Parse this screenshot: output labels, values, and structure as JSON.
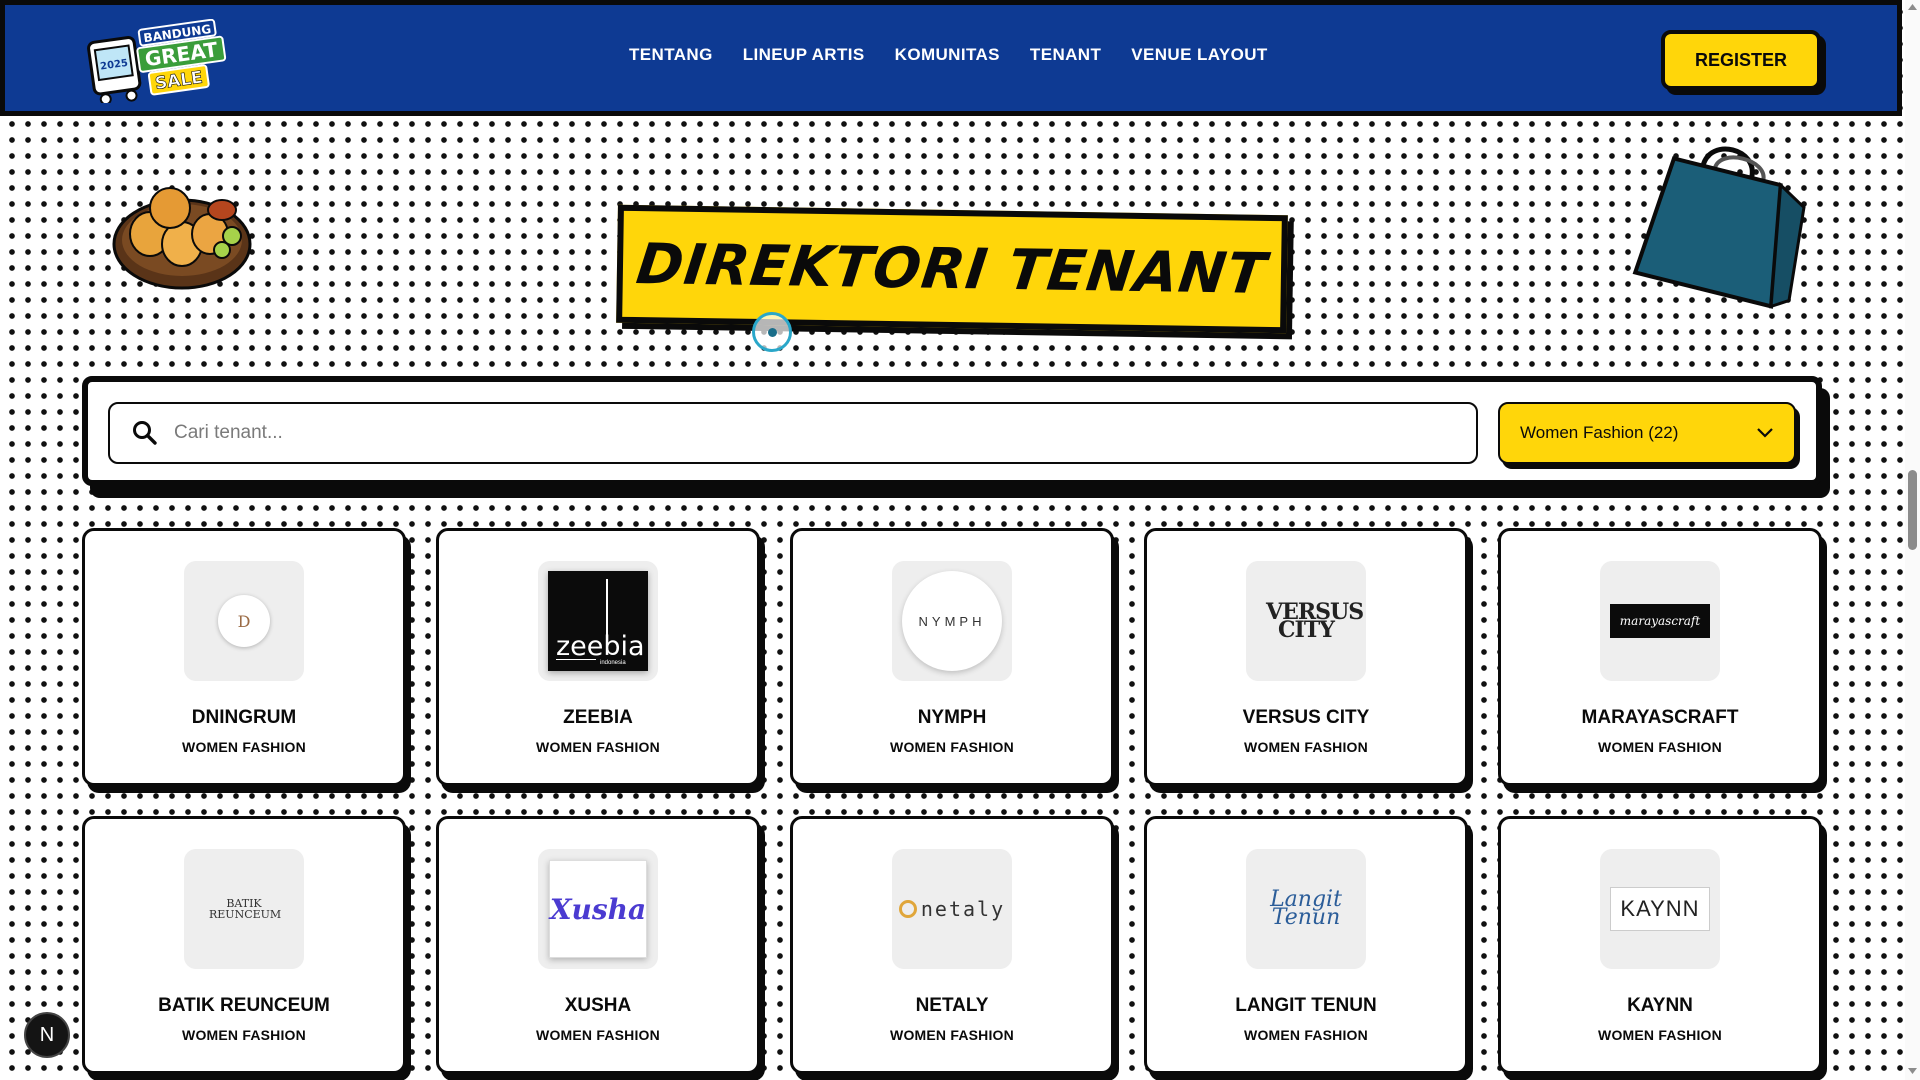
{
  "header": {
    "logo": {
      "year": "2025",
      "line1": "BANDUNG",
      "line2": "GREAT",
      "line3": "SALE"
    },
    "nav": [
      {
        "label": "TENTANG"
      },
      {
        "label": "LINEUP ARTIS"
      },
      {
        "label": "KOMUNITAS"
      },
      {
        "label": "TENANT"
      },
      {
        "label": "VENUE LAYOUT"
      }
    ],
    "register_label": "REGISTER"
  },
  "hero": {
    "title": "DIREKTORI TENANT"
  },
  "search": {
    "placeholder": "Cari tenant...",
    "value": ""
  },
  "filter": {
    "selected": "Women Fashion (22)"
  },
  "tenants": [
    {
      "name": "DNINGRUM",
      "category": "WOMEN FASHION",
      "logo_text": "D"
    },
    {
      "name": "ZEEBIA",
      "category": "WOMEN FASHION",
      "logo_text": "zeebia",
      "logo_sub": "indonesia"
    },
    {
      "name": "NYMPH",
      "category": "WOMEN FASHION",
      "logo_text": "NYMPH"
    },
    {
      "name": "VERSUS CITY",
      "category": "WOMEN FASHION",
      "logo_text": "VERSUS CITY"
    },
    {
      "name": "MARAYASCRAFT",
      "category": "WOMEN FASHION",
      "logo_text": "marayascraft"
    },
    {
      "name": "BATIK REUNCEUM",
      "category": "WOMEN FASHION",
      "logo_text": "BATIK REUNCEUM"
    },
    {
      "name": "XUSHA",
      "category": "WOMEN FASHION",
      "logo_text": "Xusha"
    },
    {
      "name": "NETALY",
      "category": "WOMEN FASHION",
      "logo_text": "netaly"
    },
    {
      "name": "LANGIT TENUN",
      "category": "WOMEN FASHION",
      "logo_text": "Langit Tenun"
    },
    {
      "name": "KAYNN",
      "category": "WOMEN FASHION",
      "logo_text": "KAYNN"
    }
  ],
  "dev_badge": "N",
  "colors": {
    "navy": "#0e3a93",
    "yellow": "#ffd60a",
    "black": "#0a0a0a"
  },
  "icons": [
    "search-icon",
    "chevron-down-icon",
    "food-illustration",
    "shopping-bag-illustration"
  ]
}
